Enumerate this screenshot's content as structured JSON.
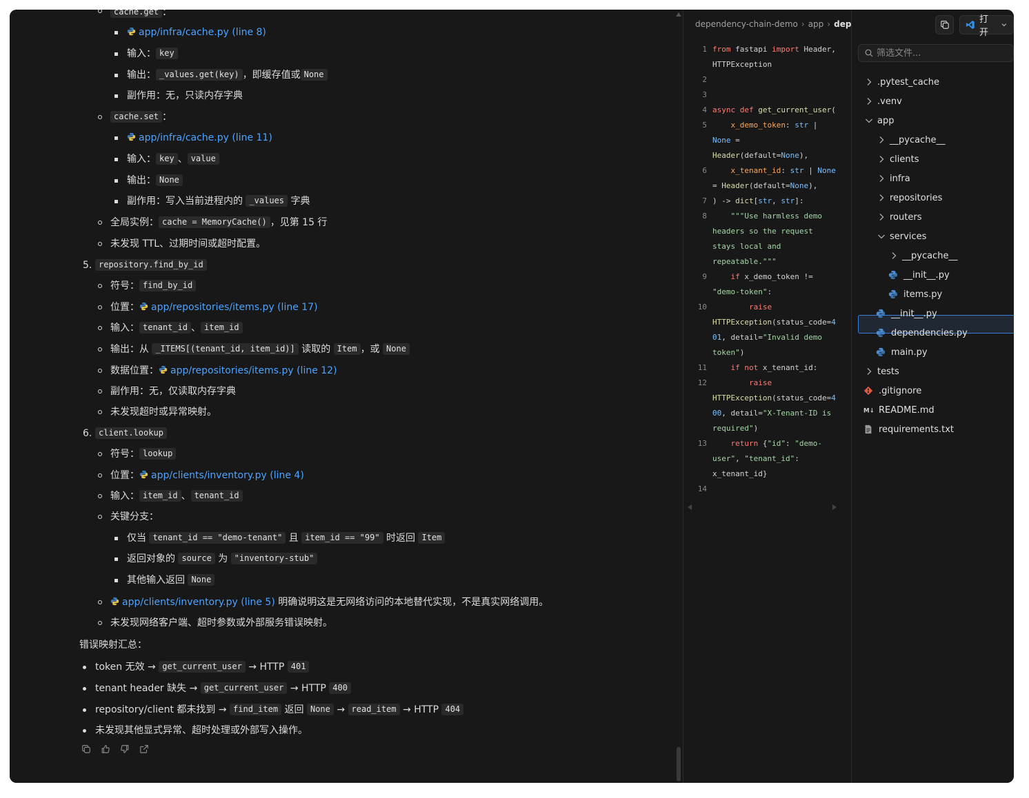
{
  "chat": {
    "cache_get": "cache.get",
    "l1_link": "app/infra/cache.py (line 8)",
    "l2_label": "输入：",
    "l2_code": "key",
    "l3_label": "输出：",
    "l3_code1": "_values.get(key)",
    "l3_mid": "，即缓存值或",
    "l3_code2": "None",
    "l4_text": "副作用：无，只读内存字典",
    "cache_set": "cache.set",
    "l6_link": "app/infra/cache.py (line 11)",
    "l7_label": "输入：",
    "l7_code1": "key",
    "l7_sep": "、",
    "l7_code2": "value",
    "l8_label": "输出：",
    "l8_code": "None",
    "l9_pre": "副作用：写入当前进程内的",
    "l9_code": "_values",
    "l9_post": "字典",
    "l10_pre": "全局实例：",
    "l10_code": "cache = MemoryCache()",
    "l10_post": "，见第 15 行",
    "l11_text": "未发现 TTL、过期时间或超时配置。",
    "n5": "5.",
    "n5_code": "repository.find_by_id",
    "r1_label": "符号：",
    "r1_code": "find_by_id",
    "r2_label": "位置：",
    "r2_link": "app/repositories/items.py (line 17)",
    "r3_label": "输入：",
    "r3_code1": "tenant_id",
    "r3_sep": "、",
    "r3_code2": "item_id",
    "r4_pre": "输出：从",
    "r4_code1": "_ITEMS[(tenant_id, item_id)]",
    "r4_mid": "读取的",
    "r4_code2": "Item",
    "r4_mid2": "，或",
    "r4_code3": "None",
    "r5_label": "数据位置：",
    "r5_link": "app/repositories/items.py (line 12)",
    "r6_text": "副作用：无，仅读取内存字典",
    "r7_text": "未发现超时或异常映射。",
    "n6": "6.",
    "n6_code": "client.lookup",
    "c1_label": "符号：",
    "c1_code": "lookup",
    "c2_label": "位置：",
    "c2_link": "app/clients/inventory.py (line 4)",
    "c3_label": "输入：",
    "c3_code1": "item_id",
    "c3_sep": "、",
    "c3_code2": "tenant_id",
    "c4_text": "关键分支：",
    "c5_pre": "仅当",
    "c5_code1": "tenant_id == \"demo-tenant\"",
    "c5_mid": "且",
    "c5_code2": "item_id == \"99\"",
    "c5_mid2": "时返回",
    "c5_code3": "Item",
    "c6_pre": "返回对象的",
    "c6_code1": "source",
    "c6_mid": "为",
    "c6_code2": "\"inventory-stub\"",
    "c7_pre": "其他输入返回",
    "c7_code": "None",
    "c8_link": "app/clients/inventory.py (line 5)",
    "c8_post": "明确说明这是无网络访问的本地替代实现，不是真实网络调用。",
    "c9_text": "未发现网络客户端、超时参数或外部服务错误映射。",
    "summary_title": "错误映射汇总：",
    "s1_pre": "token 无效 →",
    "s1_code": "get_current_user",
    "s1_mid": "→ HTTP",
    "s1_code2": "401",
    "s2_pre": "tenant header 缺失 →",
    "s2_code": "get_current_user",
    "s2_mid": "→ HTTP",
    "s2_code2": "400",
    "s3_pre": "repository/client 都未找到 →",
    "s3_code": "find_item",
    "s3_mid": "返回",
    "s3_code2": "None",
    "s3_arrow": "→",
    "s3_code3": "read_item",
    "s3_mid2": "→ HTTP",
    "s3_code4": "404",
    "s4_text": "未发现其他显式异常、超时处理或外部写入操作。"
  },
  "actions": [
    "copy-icon",
    "thumbs-up-icon",
    "thumbs-down-icon",
    "share-icon"
  ],
  "editor": {
    "breadcrumb": [
      "dependency-chain-demo",
      "app",
      "dependencies.py"
    ],
    "line_numbers": [
      "1",
      "2",
      "3",
      "4",
      "5",
      "6",
      "7",
      "8",
      "9",
      "10",
      "11",
      "12",
      "13",
      "14"
    ]
  },
  "tree": {
    "open_label": "打开",
    "search_placeholder": "筛选文件...",
    "items": [
      {
        "label": ".pytest_cache",
        "type": "folder",
        "state": "collapsed"
      },
      {
        "label": ".venv",
        "type": "folder",
        "state": "collapsed"
      },
      {
        "label": "app",
        "type": "folder",
        "state": "expanded"
      },
      {
        "label": "__pycache__",
        "type": "folder",
        "state": "collapsed"
      },
      {
        "label": "clients",
        "type": "folder",
        "state": "collapsed"
      },
      {
        "label": "infra",
        "type": "folder",
        "state": "collapsed"
      },
      {
        "label": "repositories",
        "type": "folder",
        "state": "collapsed"
      },
      {
        "label": "routers",
        "type": "folder",
        "state": "collapsed"
      },
      {
        "label": "services",
        "type": "folder",
        "state": "expanded"
      },
      {
        "label": "__pycache__",
        "type": "folder",
        "state": "collapsed"
      },
      {
        "label": "__init__.py",
        "type": "python"
      },
      {
        "label": "items.py",
        "type": "python"
      },
      {
        "label": "__init__.py",
        "type": "python"
      },
      {
        "label": "dependencies.py",
        "type": "python",
        "selected": true
      },
      {
        "label": "main.py",
        "type": "python"
      },
      {
        "label": "tests",
        "type": "folder",
        "state": "collapsed"
      },
      {
        "label": ".gitignore",
        "type": "git"
      },
      {
        "label": "README.md",
        "type": "markdown"
      },
      {
        "label": "requirements.txt",
        "type": "text"
      }
    ]
  },
  "colors": {
    "link": "#4da3ff",
    "selection_border": "#3b7ddd",
    "background": "#181818"
  }
}
